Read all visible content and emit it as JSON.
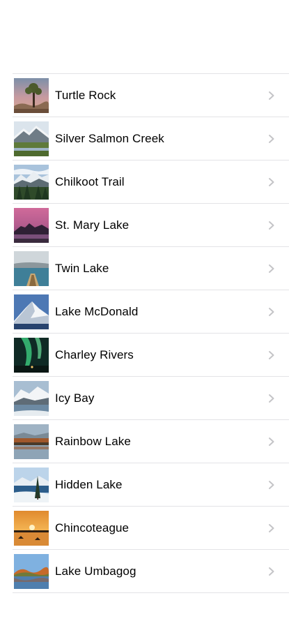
{
  "landmarks": [
    {
      "name": "Turtle Rock",
      "thumbnail": "turtlerock-photo"
    },
    {
      "name": "Silver Salmon Creek",
      "thumbnail": "silversalmoncreek-photo"
    },
    {
      "name": "Chilkoot Trail",
      "thumbnail": "chilkoottrail-photo"
    },
    {
      "name": "St. Mary Lake",
      "thumbnail": "stmarylake-photo"
    },
    {
      "name": "Twin Lake",
      "thumbnail": "twinlake-photo"
    },
    {
      "name": "Lake McDonald",
      "thumbnail": "lakemcdonald-photo"
    },
    {
      "name": "Charley Rivers",
      "thumbnail": "charleyrivers-photo"
    },
    {
      "name": "Icy Bay",
      "thumbnail": "icybay-photo"
    },
    {
      "name": "Rainbow Lake",
      "thumbnail": "rainbowlake-photo"
    },
    {
      "name": "Hidden Lake",
      "thumbnail": "hiddenlake-photo"
    },
    {
      "name": "Chincoteague",
      "thumbnail": "chincoteague-photo"
    },
    {
      "name": "Lake Umbagog",
      "thumbnail": "lakeumbagog-photo"
    }
  ],
  "colors": {
    "separator": "#e3e3e6",
    "chevron": "#c4c4c7",
    "text": "#000000"
  },
  "icons": {
    "disclosure": "chevron-right-icon"
  }
}
